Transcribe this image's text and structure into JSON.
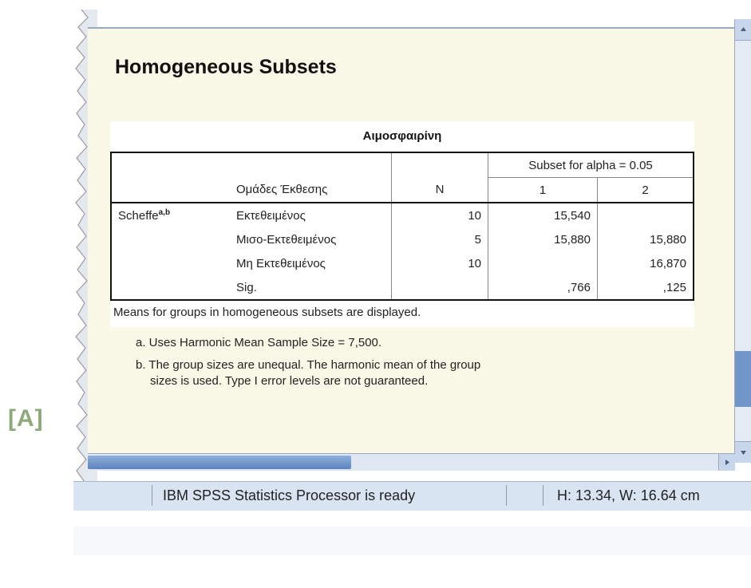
{
  "side_label": "[A]",
  "viewer": {
    "heading": "Homogeneous Subsets",
    "table": {
      "title": "Αιμοσφαιρίνη",
      "subset_header": "Subset for alpha = 0.05",
      "col_group": "Ομάδες Έκθεσης",
      "col_n": "N",
      "col_s1": "1",
      "col_s2": "2",
      "method": "Scheffe",
      "method_sup": "a,b",
      "rows": [
        {
          "group": "Εκτεθειμένος",
          "n": "10",
          "s1": "15,540",
          "s2": ""
        },
        {
          "group": "Μισο-Εκτεθειμένος",
          "n": "5",
          "s1": "15,880",
          "s2": "15,880"
        },
        {
          "group": "Μη Εκτεθειμένος",
          "n": "10",
          "s1": "",
          "s2": "16,870"
        },
        {
          "group": "Sig.",
          "n": "",
          "s1": ",766",
          "s2": ",125"
        }
      ]
    },
    "footnote_main": "Means for groups in homogeneous subsets are displayed.",
    "footnote_a": "a. Uses Harmonic Mean Sample Size = 7,500.",
    "footnote_b_line1": "b. The group sizes are unequal. The harmonic mean of the group",
    "footnote_b_line2": "sizes is used. Type I error levels are not guaranteed."
  },
  "status_bar": {
    "message": "IBM SPSS Statistics Processor is ready",
    "dimensions": "H: 13.34, W: 16.64 cm"
  },
  "colors": {
    "viewer_bg": "#faf8e6",
    "scroll_thumb": "#6f95c9",
    "status_bg": "#d9e4f3",
    "label_green": "#8faa7a"
  }
}
